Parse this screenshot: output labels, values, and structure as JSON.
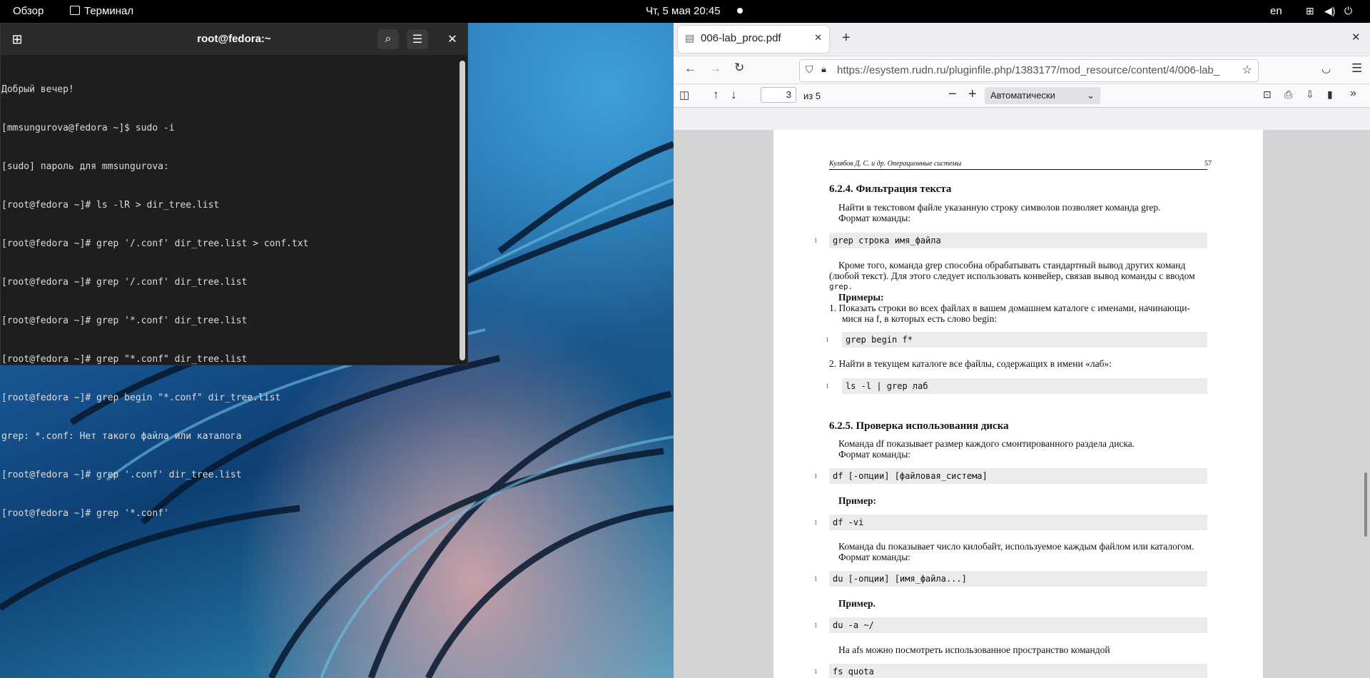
{
  "topbar": {
    "overview": "Обзор",
    "app_name": "Терминал",
    "datetime": "Чт, 5 мая  20:45",
    "lang": "en"
  },
  "terminal": {
    "title": "root@fedora:~",
    "lines": [
      "Добрый вечер!",
      "[mmsungurova@fedora ~]$ sudo -i",
      "[sudo] пароль для mmsungurova:",
      "[root@fedora ~]# ls -lR > dir_tree.list",
      "[root@fedora ~]# grep '/.conf' dir_tree.list > conf.txt",
      "[root@fedora ~]# grep '/.conf' dir_tree.list",
      "[root@fedora ~]# grep '*.conf' dir_tree.list",
      "[root@fedora ~]# grep \"*.conf\" dir_tree.list",
      "[root@fedora ~]# grep begin \"*.conf\" dir_tree.list",
      "grep: *.conf: Нет такого файла или каталога",
      "[root@fedora ~]# grep '.conf' dir_tree.list",
      "[root@fedora ~]# grep '*.conf'"
    ]
  },
  "browser": {
    "tab_title": "006-lab_proc.pdf",
    "url": "https://esystem.rudn.ru/pluginfile.php/1383177/mod_resource/content/4/006-lab_",
    "page_number": "3",
    "page_total": "из 5",
    "zoom": "Автоматически"
  },
  "pdf": {
    "header_left": "Кулябов Д. С. и др. Операционные системы",
    "header_right": "57",
    "s1_title": "6.2.4.   Фильтрация текста",
    "s1_p1": "Найти в текстовом файле указанную строку символов позволяет команда grep.",
    "s1_p1b": "Формат команды:",
    "code1": "grep строка имя_файла",
    "s1_p2a": "Кроме того, команда grep способна обрабатывать стандартный вывод других команд",
    "s1_p2b": "(любой текст). Для этого следует использовать конвейер, связав вывод команды с вводом",
    "s1_p2c": "grep.",
    "examples": "Примеры:",
    "ex1a": "1.  Показать строки во всех файлах в вашем домашнем каталоге с именами, начинающи-",
    "ex1b": "мися на f, в которых есть слово begin:",
    "code2": "grep begin f*",
    "ex2": "2.  Найти в текущем каталоге все файлы, содержащих в имени «лаб»:",
    "code3": "ls -l | grep лаб",
    "s2_title": "6.2.5.   Проверка использования диска",
    "s2_p1": "Команда df показывает размер каждого смонтированного раздела диска.",
    "s2_p1b": "Формат команды:",
    "code4": "df [-опции] [файловая_система]",
    "example1": "Пример:",
    "code5": "df -vi",
    "s2_p2": "Команда du показывает число килобайт, используемое каждым файлом или каталогом.",
    "s2_p2b": "Формат команды:",
    "code6": "du [-опции] [имя_файла...]",
    "example2": "Пример.",
    "code7": "du -a ~/",
    "s2_p3": "На afs можно посмотреть использованное пространство командой",
    "code8": "fs quota",
    "line_no": "1"
  }
}
